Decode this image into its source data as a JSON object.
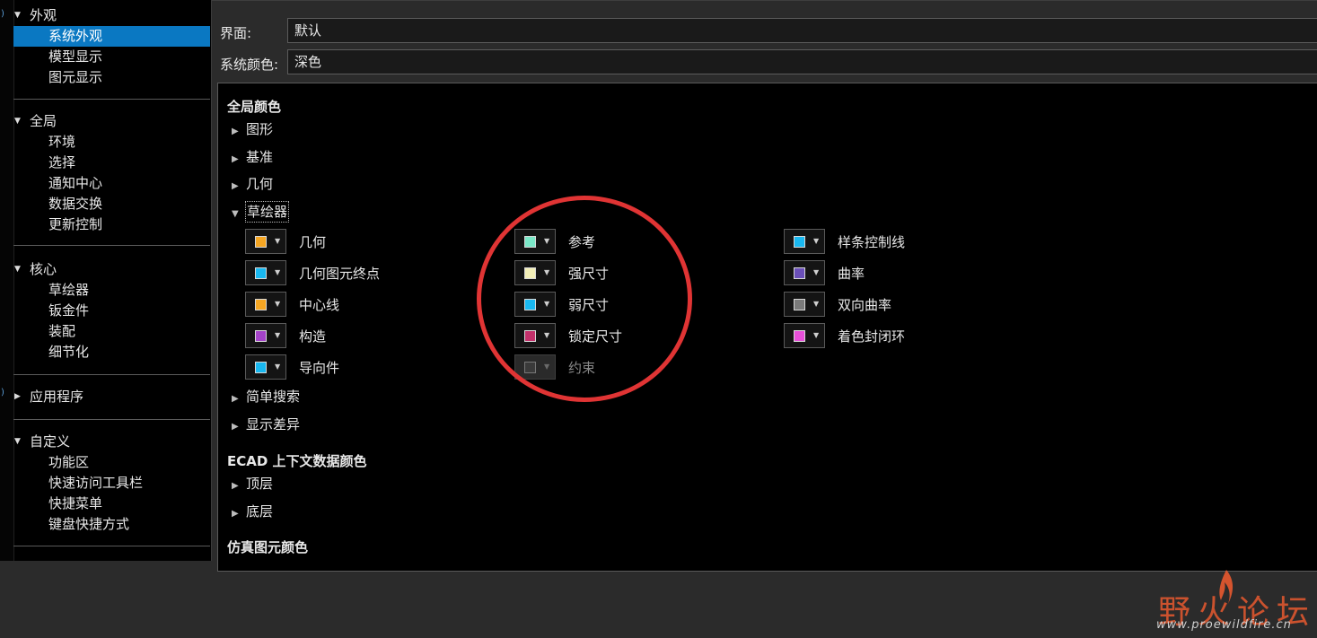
{
  "sidebar": {
    "groups": [
      {
        "title": "外观",
        "items": [
          "系统外观",
          "模型显示",
          "图元显示"
        ],
        "selected": "系统外观"
      },
      {
        "title": "全局",
        "items": [
          "环境",
          "选择",
          "通知中心",
          "数据交换",
          "更新控制"
        ]
      },
      {
        "title": "核心",
        "items": [
          "草绘器",
          "钣金件",
          "装配",
          "细节化"
        ]
      },
      {
        "title": "应用程序",
        "items": []
      },
      {
        "title": "自定义",
        "items": [
          "功能区",
          "快速访问工具栏",
          "快捷菜单",
          "键盘快捷方式"
        ]
      }
    ]
  },
  "settings": {
    "theme_label": "界面:",
    "theme_value": "默认",
    "system_color_label": "系统颜色:",
    "system_color_value": "深色"
  },
  "panel": {
    "global_colors_title": "全局颜色",
    "tree": {
      "graphics": "图形",
      "datum": "基准",
      "geometry": "几何",
      "sketcher": "草绘器",
      "simple_search": "简单搜索",
      "display_diff": "显示差异"
    },
    "sketcher_colors": {
      "col1": [
        {
          "label": "几何",
          "color": "#f5a623"
        },
        {
          "label": "几何图元终点",
          "color": "#19b8f0"
        },
        {
          "label": "中心线",
          "color": "#f5a623"
        },
        {
          "label": "构造",
          "color": "#a443c8"
        },
        {
          "label": "导向件",
          "color": "#19b8f0"
        }
      ],
      "col2": [
        {
          "label": "参考",
          "color": "#7be8c8"
        },
        {
          "label": "强尺寸",
          "color": "#f3efb8"
        },
        {
          "label": "弱尺寸",
          "color": "#19b8f0"
        },
        {
          "label": "锁定尺寸",
          "color": "#c2306a"
        },
        {
          "label": "约束",
          "color": "#3a3a3a",
          "disabled": true
        }
      ],
      "col3": [
        {
          "label": "样条控制线",
          "color": "#19b8f0"
        },
        {
          "label": "曲率",
          "color": "#6a4fb8"
        },
        {
          "label": "双向曲率",
          "color": "#7a7a7a"
        },
        {
          "label": "着色封闭环",
          "color": "#e64fd8"
        }
      ]
    },
    "ecad_title": "ECAD 上下文数据颜色",
    "ecad_tree": {
      "top": "顶层",
      "bottom": "底层"
    },
    "sim_title": "仿真图元颜色"
  },
  "watermark": {
    "text": "野火论坛",
    "url": "www.proewildfire.cn"
  },
  "colors": {
    "selection": "#0a78c2",
    "annotation_circle": "#e03434"
  }
}
